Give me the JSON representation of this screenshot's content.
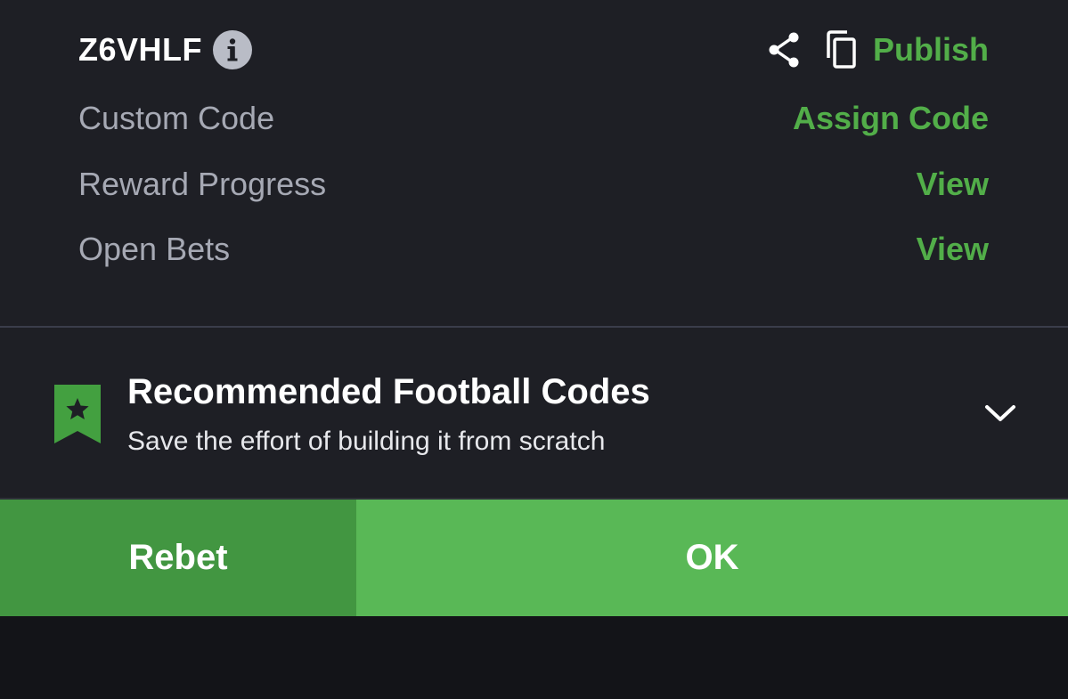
{
  "booking": {
    "code": "Z6VHLF",
    "publish_label": "Publish"
  },
  "rows": [
    {
      "label": "Custom Code",
      "action": "Assign Code"
    },
    {
      "label": "Reward Progress",
      "action": "View"
    },
    {
      "label": "Open Bets",
      "action": "View"
    }
  ],
  "recommended": {
    "title": "Recommended Football Codes",
    "subtitle": "Save the effort of building it from scratch"
  },
  "buttons": {
    "rebet_label": "Rebet",
    "ok_label": "OK"
  },
  "icons": {
    "info": "info-icon",
    "share": "share-icon",
    "copy": "copy-icon",
    "bookmark": "bookmark-star-icon",
    "chevron": "chevron-down-icon"
  },
  "colors": {
    "accent_green": "#52ae49",
    "rebet_bg": "#429641",
    "ok_bg": "#59b856",
    "panel_bg": "#1e1f25",
    "muted_text": "#a6a9b4"
  }
}
